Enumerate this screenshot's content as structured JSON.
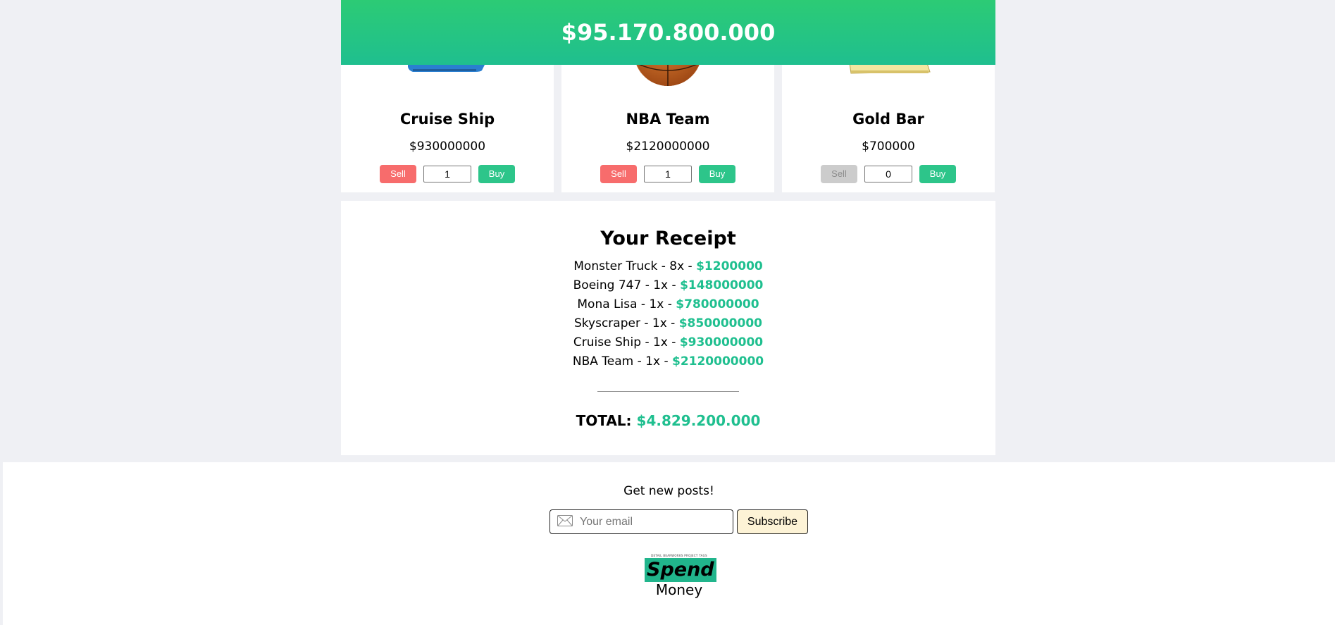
{
  "header": {
    "balance": "$95.170.800.000"
  },
  "items": [
    {
      "name": "Cruise Ship",
      "price": "$930000000",
      "quantity": "1",
      "sell_label": "Sell",
      "buy_label": "Buy",
      "sell_enabled": true
    },
    {
      "name": "NBA Team",
      "price": "$2120000000",
      "quantity": "1",
      "sell_label": "Sell",
      "buy_label": "Buy",
      "sell_enabled": true
    },
    {
      "name": "Gold Bar",
      "price": "$700000",
      "quantity": "0",
      "sell_label": "Sell",
      "buy_label": "Buy",
      "sell_enabled": false
    }
  ],
  "receipt": {
    "title": "Your Receipt",
    "lines": [
      {
        "text": "Monster Truck - 8x - ",
        "amount": "$1200000"
      },
      {
        "text": "Boeing 747 - 1x - ",
        "amount": "$148000000"
      },
      {
        "text": "Mona Lisa - 1x - ",
        "amount": "$780000000"
      },
      {
        "text": "Skyscraper - 1x - ",
        "amount": "$850000000"
      },
      {
        "text": "Cruise Ship - 1x - ",
        "amount": "$930000000"
      },
      {
        "text": "NBA Team - 1x - ",
        "amount": "$2120000000"
      }
    ],
    "total_label": "TOTAL:",
    "total_amount": "$4.829.200.000"
  },
  "footer": {
    "prompt": "Get new posts!",
    "email_placeholder": "Your email",
    "subscribe_label": "Subscribe",
    "logo": {
      "tagline": "DETAIL BEARWORKS PROJECT TAGS",
      "word1": "Spend",
      "word2": "Money"
    }
  },
  "colors": {
    "accent": "#1fbf8f",
    "sell": "#f76c6c",
    "buy": "#2dc58a",
    "subscribe_bg": "#fdf3d6"
  }
}
